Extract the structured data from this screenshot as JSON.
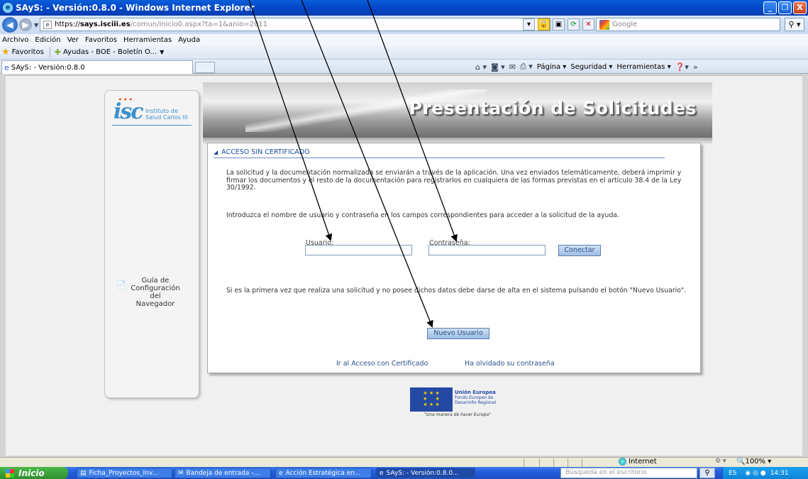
{
  "window": {
    "title": "SAyS: - Versión:0.8.0 - Windows Internet Explorer",
    "controls": [
      "_",
      "❐",
      "X"
    ]
  },
  "address": {
    "scheme": "https://",
    "host": "says.isciii.es",
    "path": "/comun/Inicio0.aspx?ta=1&anio=2011",
    "search_placeholder": "Google"
  },
  "menu": [
    "Archivo",
    "Edición",
    "Ver",
    "Favoritos",
    "Herramientas",
    "Ayuda"
  ],
  "favorites": {
    "label": "Favoritos",
    "item": "Ayudas - BOE - Boletín O..."
  },
  "tab": {
    "label": "SAyS: - Versión:0.8.0"
  },
  "commandbar": {
    "pagina": "Página",
    "seguridad": "Seguridad",
    "herramientas": "Herramientas"
  },
  "sidebar": {
    "logo_line1": "Instituto de",
    "logo_line2": "Salud Carlos III",
    "guide_link": "Guía de Configuración del Navegador"
  },
  "header": {
    "title": "Presentación de Solicitudes"
  },
  "form": {
    "section_title": "ACCESO SIN CERTIFICADO",
    "intro": "La solicitud y la documentación normalizada se enviarán a través de la aplicación. Una vez enviados telemáticamente, deberá imprimir y firmar los documentos y el resto de la documentación para registrarlos en cualquiera de las formas previstas en el artículo 38.4 de la Ley 30/1992.",
    "instructions": "Introduzca el nombre de usuario y contraseña en los campos correspondientes para acceder a la solicitud de la ayuda.",
    "user_label": "Usuario:",
    "password_label": "Contraseña:",
    "connect_button": "Conectar",
    "new_user_text": "Si es la primera vez que realiza una solicitud y no posee dichos datos debe darse de alta en el sistema pulsando el botón \"Nuevo Usuario\".",
    "new_user_button": "Nuevo Usuario",
    "cert_link": "Ir al Acceso con Certificado",
    "forgot_link": "Ha olvidado su contraseña"
  },
  "eu_logo": {
    "line1": "Unión Europea",
    "line2": "Fondo Europeo de",
    "line3": "Desarrollo Regional",
    "motto": "\"Una manera de hacer Europa\""
  },
  "status": {
    "zone": "Internet",
    "zoom": "100%"
  },
  "taskbar": {
    "start": "Inicio",
    "items": [
      "Ficha_Proyectos_Inv...",
      "Bandeja de entrada -...",
      "Acción Estratégica en...",
      "SAyS: - Versión:0.8.0..."
    ],
    "search_placeholder": "Búsqueda en el escritorio",
    "lang": "ES",
    "time": "14:31"
  }
}
